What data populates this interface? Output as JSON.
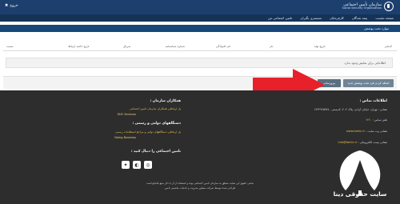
{
  "header": {
    "logo_fa": "سازمان تأمین اجتماعی",
    "logo_en": "Social Security Organization",
    "exit_label": "خروج"
  },
  "nav": {
    "items": [
      "صفحه نخست",
      "بیمه شدگان",
      "کارفرمایان",
      "مستمری بگیران",
      "تامین اجتماعی من"
    ]
  },
  "panel": {
    "title": "موارد تحت پوشش",
    "columns": [
      "کدملی",
      "تاریخ تولد",
      "نام",
      "نام خانوادگی",
      "شماره شناسنامه",
      "سریال",
      "تاریخ خاتمه ارتباط",
      "نسبت"
    ],
    "empty_message": "اطلاعاتی برای نمایش وجود ندارد",
    "add_button": "اضافه کردن فرد تحت پوشش جدید",
    "return_button": "بیروزسانی"
  },
  "footer": {
    "contact": {
      "title": "اطلاعات تماس :",
      "address": "نشانی : تهران، خیابان آزادی، پلاک ۲۰۴، کدپستی ۱۳۶۴۹۶۵۳۸۷۰",
      "phone_label": "تلفن تماس :",
      "phone": "۱۴۲۰",
      "site_label": "نشانی وب سایت :",
      "site": "www.tamin.ir",
      "email_label": "نشانی پست الکترونیکی :",
      "email": "info@tamin.ir"
    },
    "partners": {
      "title": "همکاران سازمان :",
      "link": "پل ارتباطی همکاران سازمان تامین اجتماعی",
      "link_sub": "EHC Services"
    },
    "gov": {
      "title": "دستگاههای دولتی و رسمی :",
      "link": "پل ارتباطی دستگاههای دولتی و مراجع استعلامات رسمی",
      "link_sub": "Doing Business"
    },
    "social": {
      "title": "تامین اجتماعی را دنبال کنید :",
      "icons": [
        "instagram-icon",
        "eitaa-icon",
        "bale-icon"
      ]
    },
    "copyright_1": "تمامی حقوق این سایت متعلق به سازمان تامین اجتماعی بوده و استفاده از آن با ذکر منبع بلامانع است",
    "copyright_2": "طراحی شده توسط شرکت مشاور مدیریت و خدمات ماشینی تامین"
  },
  "watermark": {
    "text": "سایت حقوقی دینا"
  },
  "colors": {
    "header_bg": "#1c3f6e",
    "panel_title_bg": "#174679",
    "footer_bg": "#2d2d2d",
    "link": "#e9c04b",
    "arrow": "#e8202a"
  }
}
